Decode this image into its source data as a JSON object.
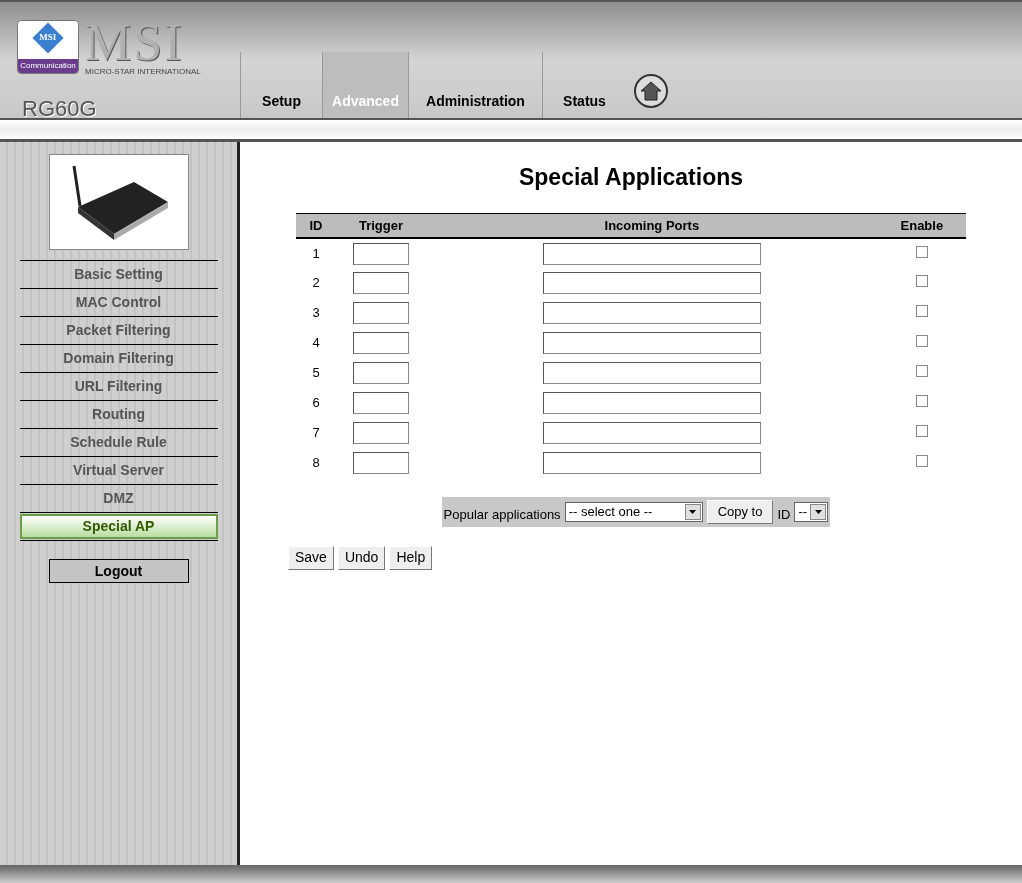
{
  "logo": {
    "badge_text": "MSI",
    "badge_caption": "Communication",
    "wordmark": "MSI",
    "tagline": "MICRO-STAR INTERNATIONAL"
  },
  "model": "RG60G",
  "tabs": [
    {
      "label": "Setup",
      "selected": false
    },
    {
      "label": "Advanced",
      "selected": true
    },
    {
      "label": "Administration",
      "selected": false
    },
    {
      "label": "Status",
      "selected": false
    }
  ],
  "sidebar": {
    "items": [
      {
        "label": "Basic Setting",
        "selected": false
      },
      {
        "label": "MAC Control",
        "selected": false
      },
      {
        "label": "Packet Filtering",
        "selected": false
      },
      {
        "label": "Domain Filtering",
        "selected": false
      },
      {
        "label": "URL Filtering",
        "selected": false
      },
      {
        "label": "Routing",
        "selected": false
      },
      {
        "label": "Schedule Rule",
        "selected": false
      },
      {
        "label": "Virtual Server",
        "selected": false
      },
      {
        "label": "DMZ",
        "selected": false
      },
      {
        "label": "Special AP",
        "selected": true
      }
    ],
    "logout": "Logout"
  },
  "title": "Special Applications",
  "table": {
    "columns": [
      "ID",
      "Trigger",
      "Incoming Ports",
      "Enable"
    ],
    "rows": [
      {
        "id": "1",
        "checked": false
      },
      {
        "id": "2",
        "checked": false
      },
      {
        "id": "3",
        "checked": false
      },
      {
        "id": "4",
        "checked": false
      },
      {
        "id": "5",
        "checked": false
      },
      {
        "id": "6",
        "checked": false
      },
      {
        "id": "7",
        "checked": false
      },
      {
        "id": "8",
        "checked": false
      }
    ]
  },
  "popular": {
    "label": "Popular applications",
    "select_value": "-- select one --",
    "copy_button": "Copy to",
    "id_label": "ID",
    "id_value": "--"
  },
  "buttons": [
    "Save",
    "Undo",
    "Help"
  ]
}
